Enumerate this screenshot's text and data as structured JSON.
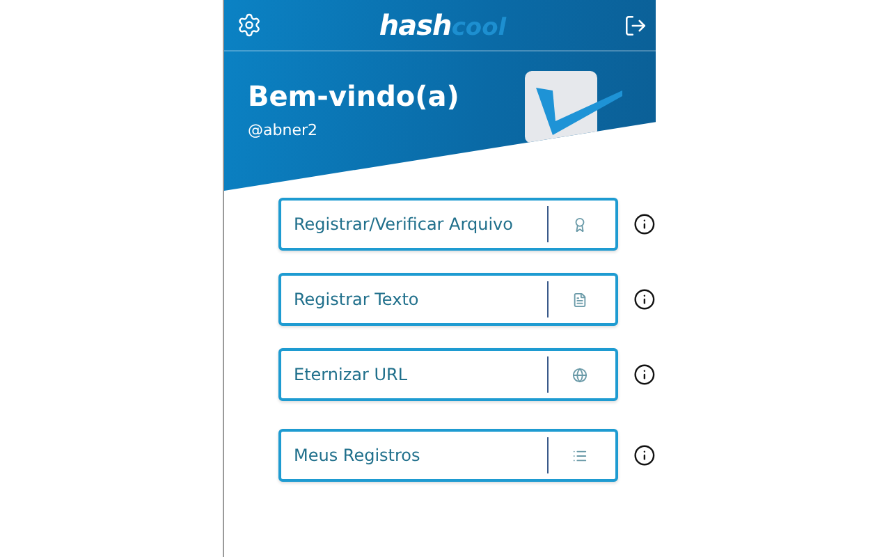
{
  "header": {
    "logo": {
      "primary": "hash",
      "secondary": "cool"
    },
    "title": "Bem-vindo(a)",
    "username": "@abner2"
  },
  "actions": [
    {
      "label": "Registrar/Verificar Arquivo"
    },
    {
      "label": "Registrar Texto"
    },
    {
      "label": "Eternizar URL"
    },
    {
      "label": "Meus Registros"
    }
  ]
}
